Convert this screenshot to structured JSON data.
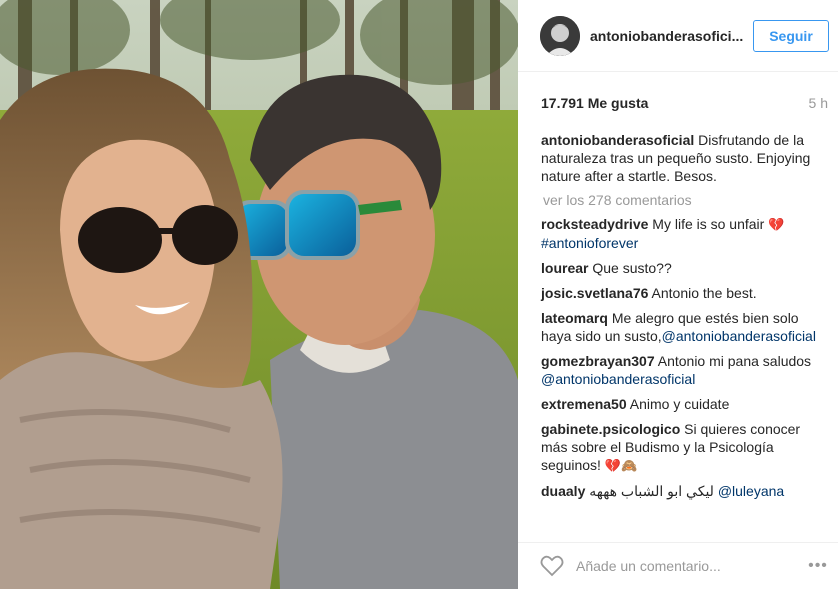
{
  "header": {
    "username": "antoniobanderasofici...",
    "follow_label": "Seguir"
  },
  "post": {
    "likes": "17.791 Me gusta",
    "time": "5 h",
    "caption": {
      "user": "antoniobanderasoficial",
      "text": "Disfrutando de la naturaleza tras un pequeño susto. Enjoying nature after a startle. Besos."
    },
    "view_all": "ver los 278 comentarios"
  },
  "comments": [
    {
      "user": "rocksteadydrive",
      "text": "My life is so unfair ",
      "emoji": "💔",
      "mention": "#antonioforever"
    },
    {
      "user": "lourear",
      "text": "Que susto??"
    },
    {
      "user": "josic.svetlana76",
      "text": "Antonio the best."
    },
    {
      "user": "lateomarq",
      "text": "Me alegro que estés bien solo haya sido un susto,",
      "mention": "@antoniobanderasoficial"
    },
    {
      "user": "gomezbrayan307",
      "text": "Antonio mi pana saludos ",
      "mention": "@antoniobanderasoficial"
    },
    {
      "user": "extremena50",
      "text": "Animo y cuidate"
    },
    {
      "user": "gabinete.psicologico",
      "text": "Si quieres conocer más sobre el Budismo y la Psicología seguinos! ",
      "emoji": "💔🙈"
    },
    {
      "user": "duaaly",
      "text": "ليكي ابو الشباب هههه ",
      "mention": "@luleyana"
    }
  ],
  "footer": {
    "add_comment_placeholder": "Añade un comentario...",
    "more": "•••"
  },
  "icons": {
    "heart": "heart-icon",
    "more": "more-options-icon"
  },
  "colors": {
    "accent": "#3897f0",
    "mention": "#003569",
    "muted": "#999999"
  }
}
